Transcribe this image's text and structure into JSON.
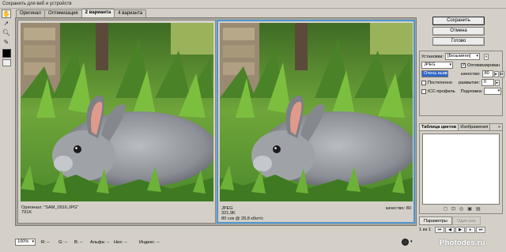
{
  "window": {
    "title": "Сохранить для веб и устройств"
  },
  "tabs": [
    {
      "label": "Оригинал",
      "active": false
    },
    {
      "label": "Оптимизация",
      "active": false
    },
    {
      "label": "2 варианта",
      "active": true
    },
    {
      "label": "4 варианта",
      "active": false
    }
  ],
  "toolbar": {
    "tools": [
      "hand-tool-icon",
      "slice-select-icon",
      "zoom-icon",
      "eyedropper-icon"
    ],
    "color_swatch": "#000000"
  },
  "original_pane": {
    "name_line": "Оригинал: \"SAM_0916.JPG\"",
    "size_line": "791K"
  },
  "optimized_pane": {
    "format_line": "JPEG",
    "size_line": "321,9K",
    "time_line": "80 сек @ 28,8 кбит/с",
    "quality_line": "качество: 80"
  },
  "buttons": {
    "save": "Сохранить",
    "cancel": "Отмена",
    "done": "Готово"
  },
  "settings": {
    "preset_label": "Установки:",
    "preset_value": "[Безымянн]",
    "format_value": "JPEG",
    "optimized_label": "Оптимизирован",
    "quality_preset": "Очень высо",
    "quality_label": "качество:",
    "quality_value": "80",
    "progressive_label": "Постепенно",
    "blur_label": "размытие:",
    "blur_value": "0",
    "icc_label": "ICC-профиль",
    "matte_label": "Подложка:"
  },
  "color_table": {
    "tab_label": "Таблица цветов",
    "tab2_label": "Изображения"
  },
  "bottom_tabs": {
    "params": "Параметры",
    "one_by_one": "Один раз"
  },
  "pager": {
    "counter": "1 из 1"
  },
  "status_bar": {
    "zoom": "100%",
    "r_label": "R: --",
    "g_label": "G: --",
    "b_label": "B: --",
    "alpha_label": "Альфа: --",
    "hex_label": "Hex: --",
    "index_label": "Индекс: --"
  },
  "watermark": {
    "text": "Photodes.ru"
  },
  "colors": {
    "accent": "#4f97cf",
    "selection": "#3267c8"
  }
}
